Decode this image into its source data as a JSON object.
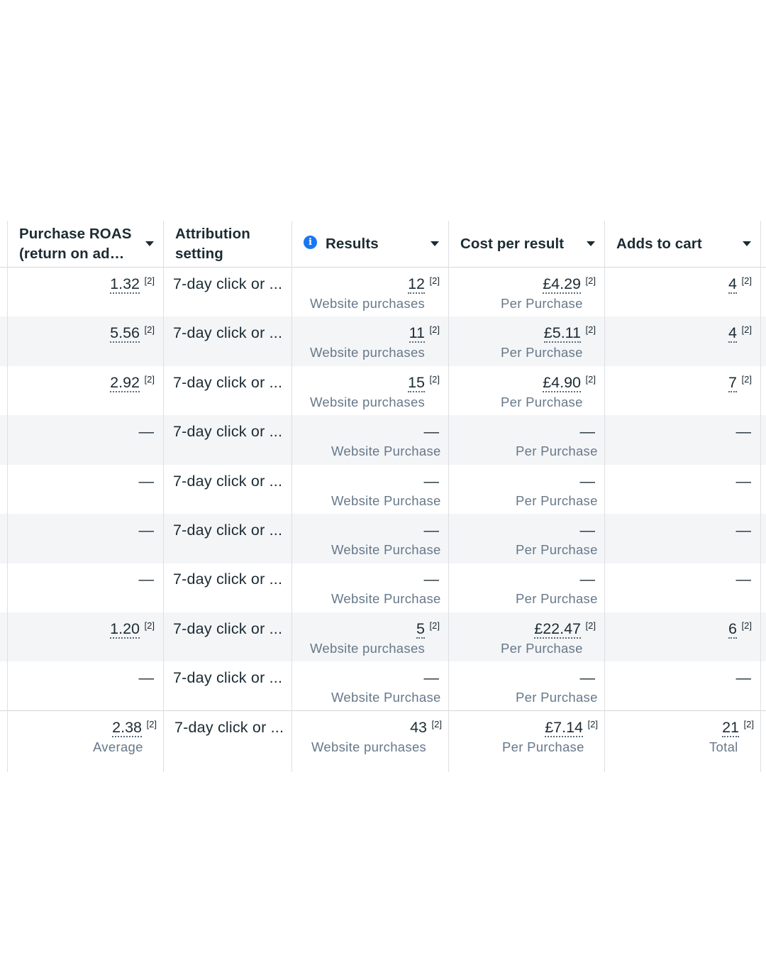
{
  "headers": {
    "roas": "Purchase ROAS (return on ad…",
    "roas_line1": "Purchase ROAS",
    "roas_line2": "(return on ad…",
    "attribution_line1": "Attribution",
    "attribution_line2": "setting",
    "results": "Results",
    "cost": "Cost per result",
    "adds": "Adds to cart"
  },
  "ref_mark": "[2]",
  "rows": [
    {
      "roas": "1.32",
      "attribution": "7-day click or ...",
      "results": "12",
      "results_sub": "Website purchases",
      "cost": "£4.29",
      "cost_sub": "Per Purchase",
      "adds": "4"
    },
    {
      "roas": "5.56",
      "attribution": "7-day click or ...",
      "results": "11",
      "results_sub": "Website purchases",
      "cost": "£5.11",
      "cost_sub": "Per Purchase",
      "adds": "4"
    },
    {
      "roas": "2.92",
      "attribution": "7-day click or ...",
      "results": "15",
      "results_sub": "Website purchases",
      "cost": "£4.90",
      "cost_sub": "Per Purchase",
      "adds": "7"
    },
    {
      "roas": "—",
      "attribution": "7-day click or ...",
      "results": "—",
      "results_sub": "Website Purchase",
      "cost": "—",
      "cost_sub": "Per Purchase",
      "adds": "—"
    },
    {
      "roas": "—",
      "attribution": "7-day click or ...",
      "results": "—",
      "results_sub": "Website Purchase",
      "cost": "—",
      "cost_sub": "Per Purchase",
      "adds": "—"
    },
    {
      "roas": "—",
      "attribution": "7-day click or ...",
      "results": "—",
      "results_sub": "Website Purchase",
      "cost": "—",
      "cost_sub": "Per Purchase",
      "adds": "—"
    },
    {
      "roas": "—",
      "attribution": "7-day click or ...",
      "results": "—",
      "results_sub": "Website Purchase",
      "cost": "—",
      "cost_sub": "Per Purchase",
      "adds": "—"
    },
    {
      "roas": "1.20",
      "attribution": "7-day click or ...",
      "results": "5",
      "results_sub": "Website purchases",
      "cost": "£22.47",
      "cost_sub": "Per Purchase",
      "adds": "6"
    },
    {
      "roas": "—",
      "attribution": "7-day click or ...",
      "results": "—",
      "results_sub": "Website Purchase",
      "cost": "—",
      "cost_sub": "Per Purchase",
      "adds": "—"
    }
  ],
  "totals": {
    "roas": "2.38",
    "roas_sub": "Average",
    "attribution": "7-day click or ...",
    "results": "43",
    "results_sub": "Website purchases",
    "cost": "£7.14",
    "cost_sub": "Per Purchase",
    "adds": "21",
    "adds_sub": "Total"
  }
}
